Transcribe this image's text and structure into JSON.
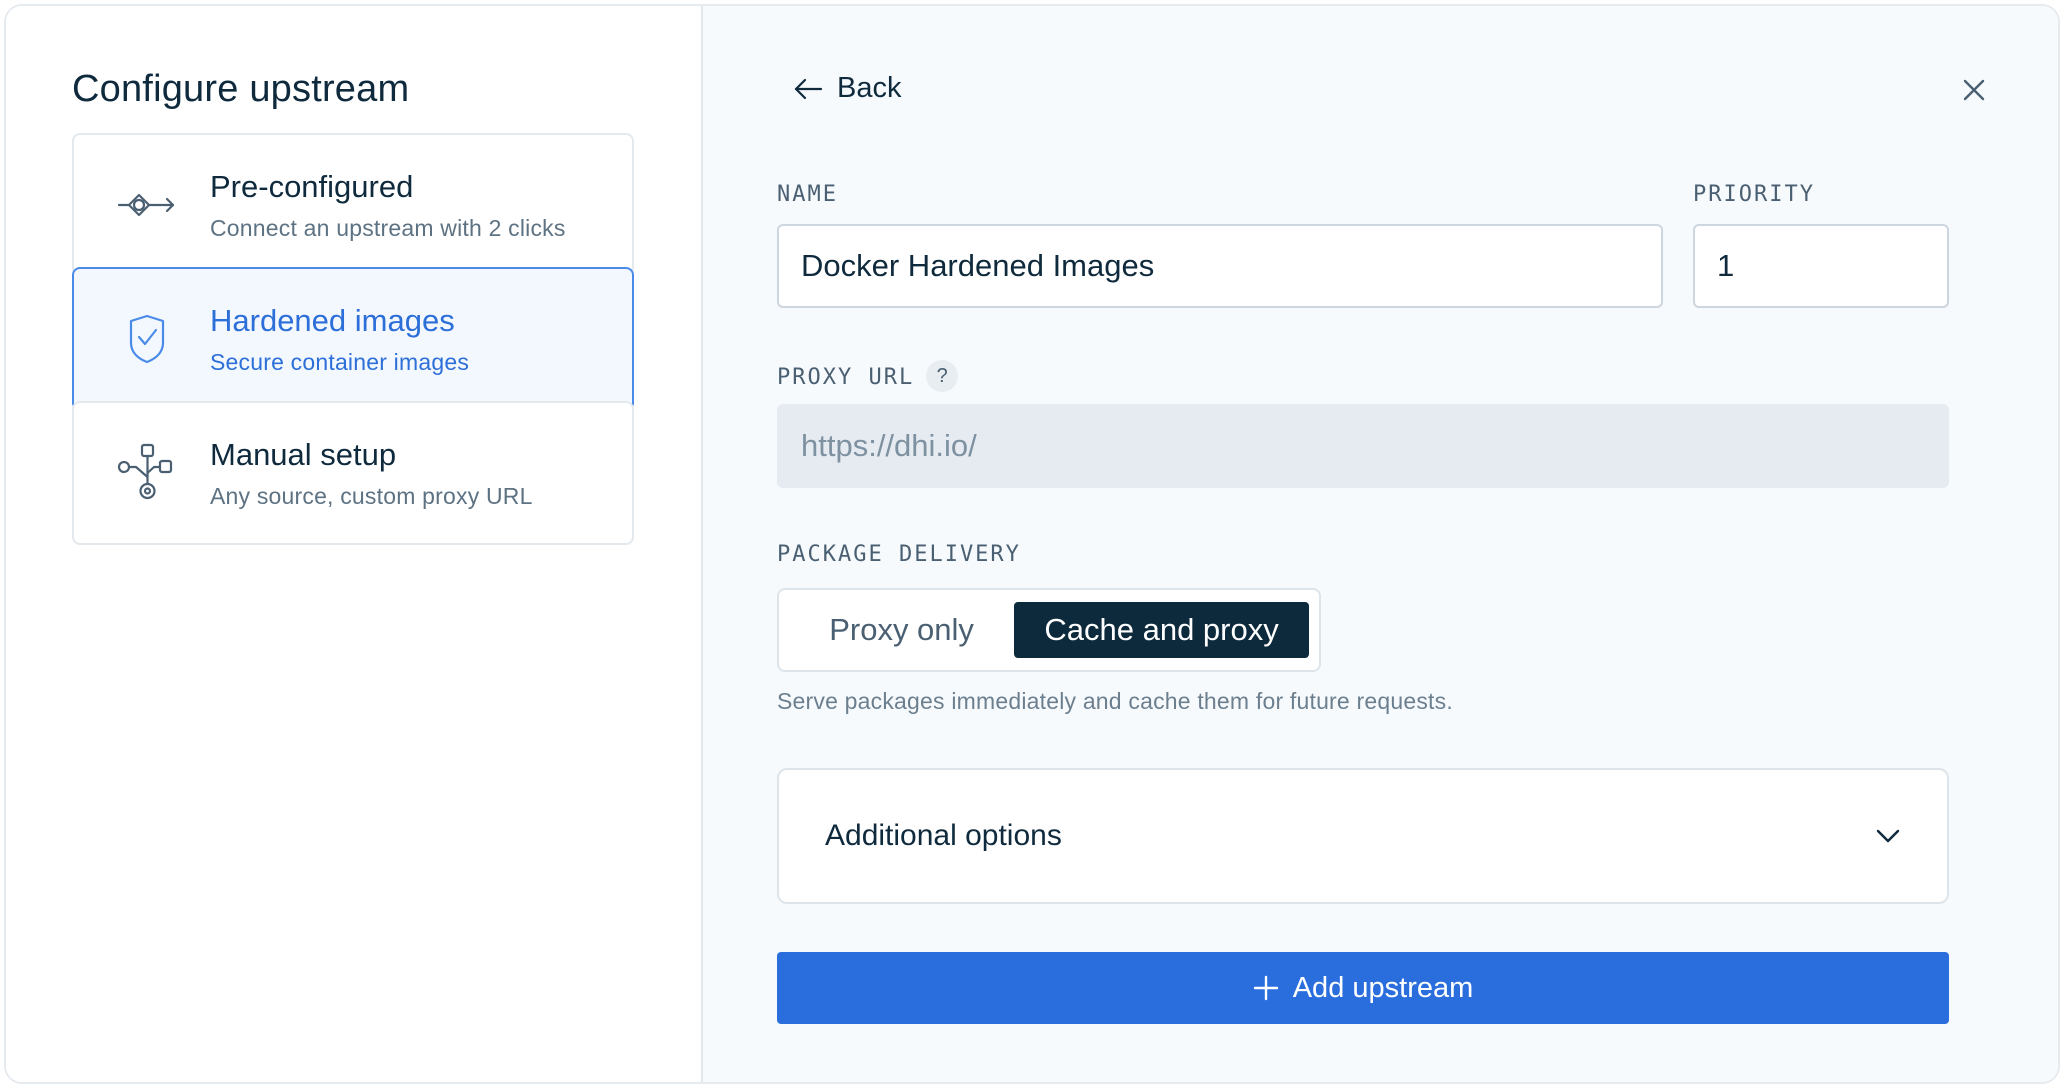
{
  "left": {
    "title": "Configure upstream",
    "options": [
      {
        "title": "Pre-configured",
        "subtitle": "Connect an upstream with 2 clicks",
        "icon": "connect-icon",
        "selected": false
      },
      {
        "title": "Hardened images",
        "subtitle": "Secure container images",
        "icon": "shield-check-icon",
        "selected": true
      },
      {
        "title": "Manual setup",
        "subtitle": "Any source, custom proxy URL",
        "icon": "network-branch-icon",
        "selected": false
      }
    ]
  },
  "right": {
    "back_label": "Back",
    "name_label": "NAME",
    "name_value": "Docker Hardened Images",
    "priority_label": "PRIORITY",
    "priority_value": "1",
    "proxy_url_label": "PROXY URL",
    "proxy_help": "?",
    "proxy_url_value": "https://dhi.io/",
    "delivery_label": "PACKAGE DELIVERY",
    "delivery_options": [
      "Proxy only",
      "Cache and proxy"
    ],
    "delivery_selected": "Cache and proxy",
    "delivery_note": "Serve packages immediately and cache them for future requests.",
    "additional_options": "Additional options",
    "submit_label": "Add upstream"
  },
  "colors": {
    "accent": "#2a6ede",
    "selected_border": "#4a8be8",
    "dark": "#0d2a3c"
  }
}
